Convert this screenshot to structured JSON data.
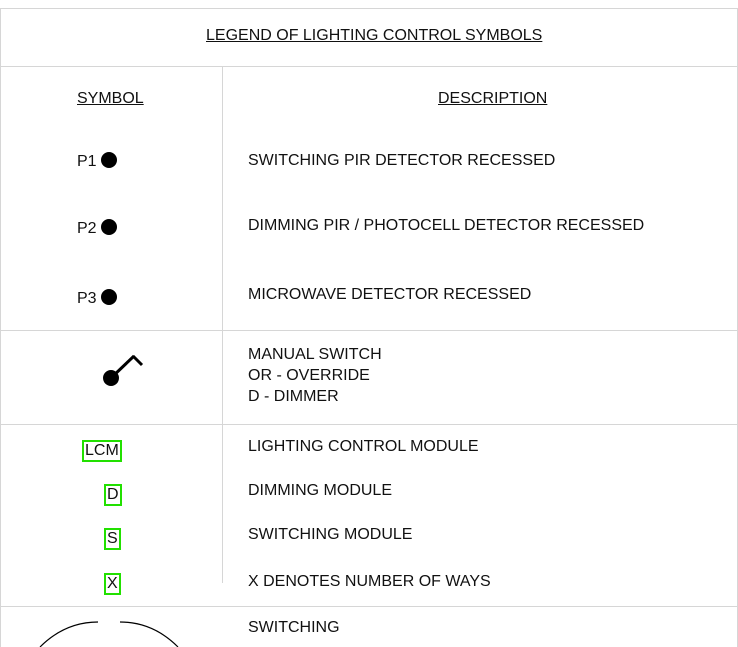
{
  "title": "LEGEND OF LIGHTING CONTROL SYMBOLS",
  "headers": {
    "symbol": "SYMBOL",
    "description": "DESCRIPTION"
  },
  "rows": [
    {
      "symbol": "P1",
      "description": "SWITCHING PIR DETECTOR RECESSED"
    },
    {
      "symbol": "P2",
      "description": "DIMMING PIR / PHOTOCELL DETECTOR RECESSED"
    },
    {
      "symbol": "P3",
      "description": "MICROWAVE DETECTOR RECESSED"
    },
    {
      "symbol": "",
      "description_lines": [
        "MANUAL SWITCH",
        "OR - OVERRIDE",
        "D - DIMMER"
      ]
    },
    {
      "symbol": "LCM",
      "description": "LIGHTING CONTROL MODULE"
    },
    {
      "symbol": "D",
      "description": "DIMMING MODULE"
    },
    {
      "symbol": "S",
      "description": "SWITCHING MODULE"
    },
    {
      "symbol": "X",
      "description": "X DENOTES NUMBER OF WAYS"
    },
    {
      "symbol": "",
      "description": "SWITCHING"
    }
  ],
  "colors": {
    "module_box_border": "#22e000",
    "grid_line": "#d6d6d6"
  },
  "icons": {
    "detector": "filled-circle-icon",
    "switch": "manual-switch-icon",
    "switching": "switching-arc-icon"
  }
}
